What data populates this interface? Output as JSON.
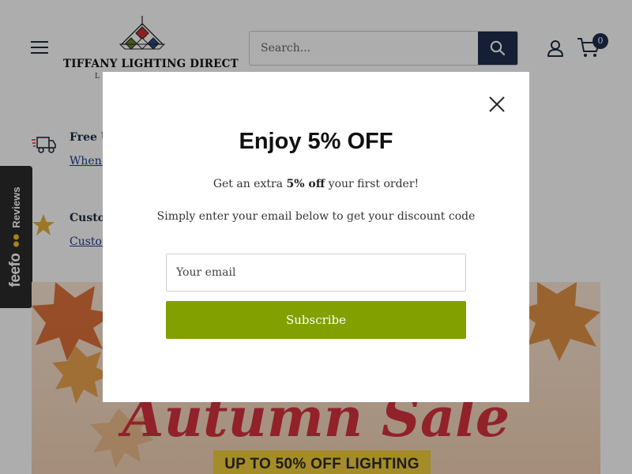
{
  "header": {
    "logo_text": "TIFFANY LIGHTING DIRECT",
    "logo_sub": "L",
    "search": {
      "placeholder": "Search..."
    },
    "cart": {
      "count": "0"
    }
  },
  "usps": [
    {
      "title": "Free U",
      "link": "When y"
    },
    {
      "title": "Custom",
      "link": "Custom"
    }
  ],
  "feefo": {
    "brand": "feefo",
    "label": "Reviews"
  },
  "banner": {
    "title": "Autumn Sale",
    "cta": "UP TO 50% OFF LIGHTING"
  },
  "modal": {
    "title": "Enjoy 5% OFF",
    "line1_pre": "Get an extra ",
    "line1_bold": "5% off",
    "line1_post": " your first order!",
    "line2": "Simply enter your email below to get your discount code",
    "email_placeholder": "Your email",
    "subscribe_label": "Subscribe"
  },
  "colors": {
    "navy": "#1e2d4d",
    "subscribe_green": "#82a000",
    "banner_red": "#d6333e",
    "banner_yellow": "#f2cf3c",
    "star_gold": "#e3b23c"
  },
  "icons": [
    "hamburger-icon",
    "search-icon",
    "account-icon",
    "cart-icon",
    "delivery-truck-icon",
    "star-icon",
    "close-icon",
    "maple-leaf-icon"
  ]
}
